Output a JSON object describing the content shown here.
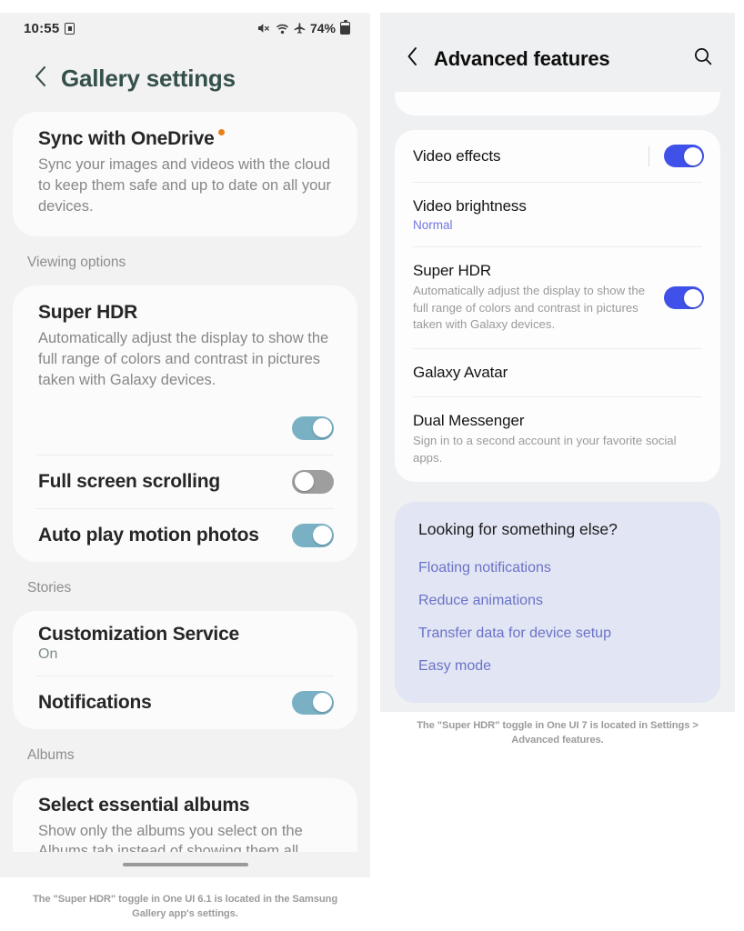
{
  "left_phone": {
    "status_bar": {
      "time": "10:55",
      "alarm_icon": "alarm-icon",
      "mute_icon": "mute-icon",
      "wifi_icon": "wifi-icon",
      "airplane_icon": "airplane-mode-icon",
      "battery_percent": "74%",
      "battery_icon": "battery-icon"
    },
    "header": {
      "back_icon": "chevron-left-icon",
      "title": "Gallery settings"
    },
    "onedrive": {
      "title": "Sync with OneDrive",
      "badge": "new-badge-dot",
      "description": "Sync your images and videos with the cloud to keep them safe and up to date on all your devices."
    },
    "sections": [
      {
        "label": "Viewing options",
        "items": [
          {
            "title": "Super HDR",
            "description": "Automatically adjust the display to show the full range of colors and contrast in pictures taken with Galaxy devices.",
            "toggle": "on",
            "layout": "stacked"
          },
          {
            "title": "Full screen scrolling",
            "toggle": "off",
            "layout": "row"
          },
          {
            "title": "Auto play motion photos",
            "toggle": "on",
            "layout": "row"
          }
        ]
      },
      {
        "label": "Stories",
        "items": [
          {
            "title": "Customization Service",
            "subtitle": "On",
            "layout": "row"
          },
          {
            "title": "Notifications",
            "toggle": "on",
            "layout": "row"
          }
        ]
      },
      {
        "label": "Albums",
        "items": [
          {
            "title": "Select essential albums",
            "description": "Show only the albums you select on the Albums tab instead of showing them all.",
            "toggle": "on",
            "layout": "stacked"
          }
        ]
      }
    ],
    "gesture_bar": "home-gesture-bar",
    "caption": "The \"Super HDR\" toggle in One UI 6.1 is located in the Samsung Gallery app's settings."
  },
  "right_phone": {
    "header": {
      "back_icon": "chevron-left-icon",
      "title": "Advanced features",
      "search_icon": "search-icon"
    },
    "items": [
      {
        "title": "Video effects",
        "toggle": "on",
        "has_separator": true
      },
      {
        "title": "Video brightness",
        "subtitle": "Normal"
      },
      {
        "title": "Super HDR",
        "description": "Automatically adjust the display to show the full range of colors and contrast in pictures taken with Galaxy devices.",
        "toggle": "on"
      },
      {
        "title": "Galaxy Avatar"
      },
      {
        "title": "Dual Messenger",
        "description": "Sign in to a second account in your favorite social apps."
      }
    ],
    "looking_for": {
      "heading": "Looking for something else?",
      "links": [
        "Floating notifications",
        "Reduce animations",
        "Transfer data for device setup",
        "Easy mode"
      ]
    },
    "caption": "The \"Super HDR\" toggle in One UI 7 is located in Settings > Advanced features."
  },
  "colors": {
    "left_toggle_on": "#79b0c4",
    "left_toggle_off": "#9e9e9e",
    "right_toggle_on": "#3f51e8",
    "left_title": "#35504b",
    "badge_dot": "#e8801a",
    "link_blue": "#6973c8",
    "looking_card_bg": "#e2e5f3"
  }
}
